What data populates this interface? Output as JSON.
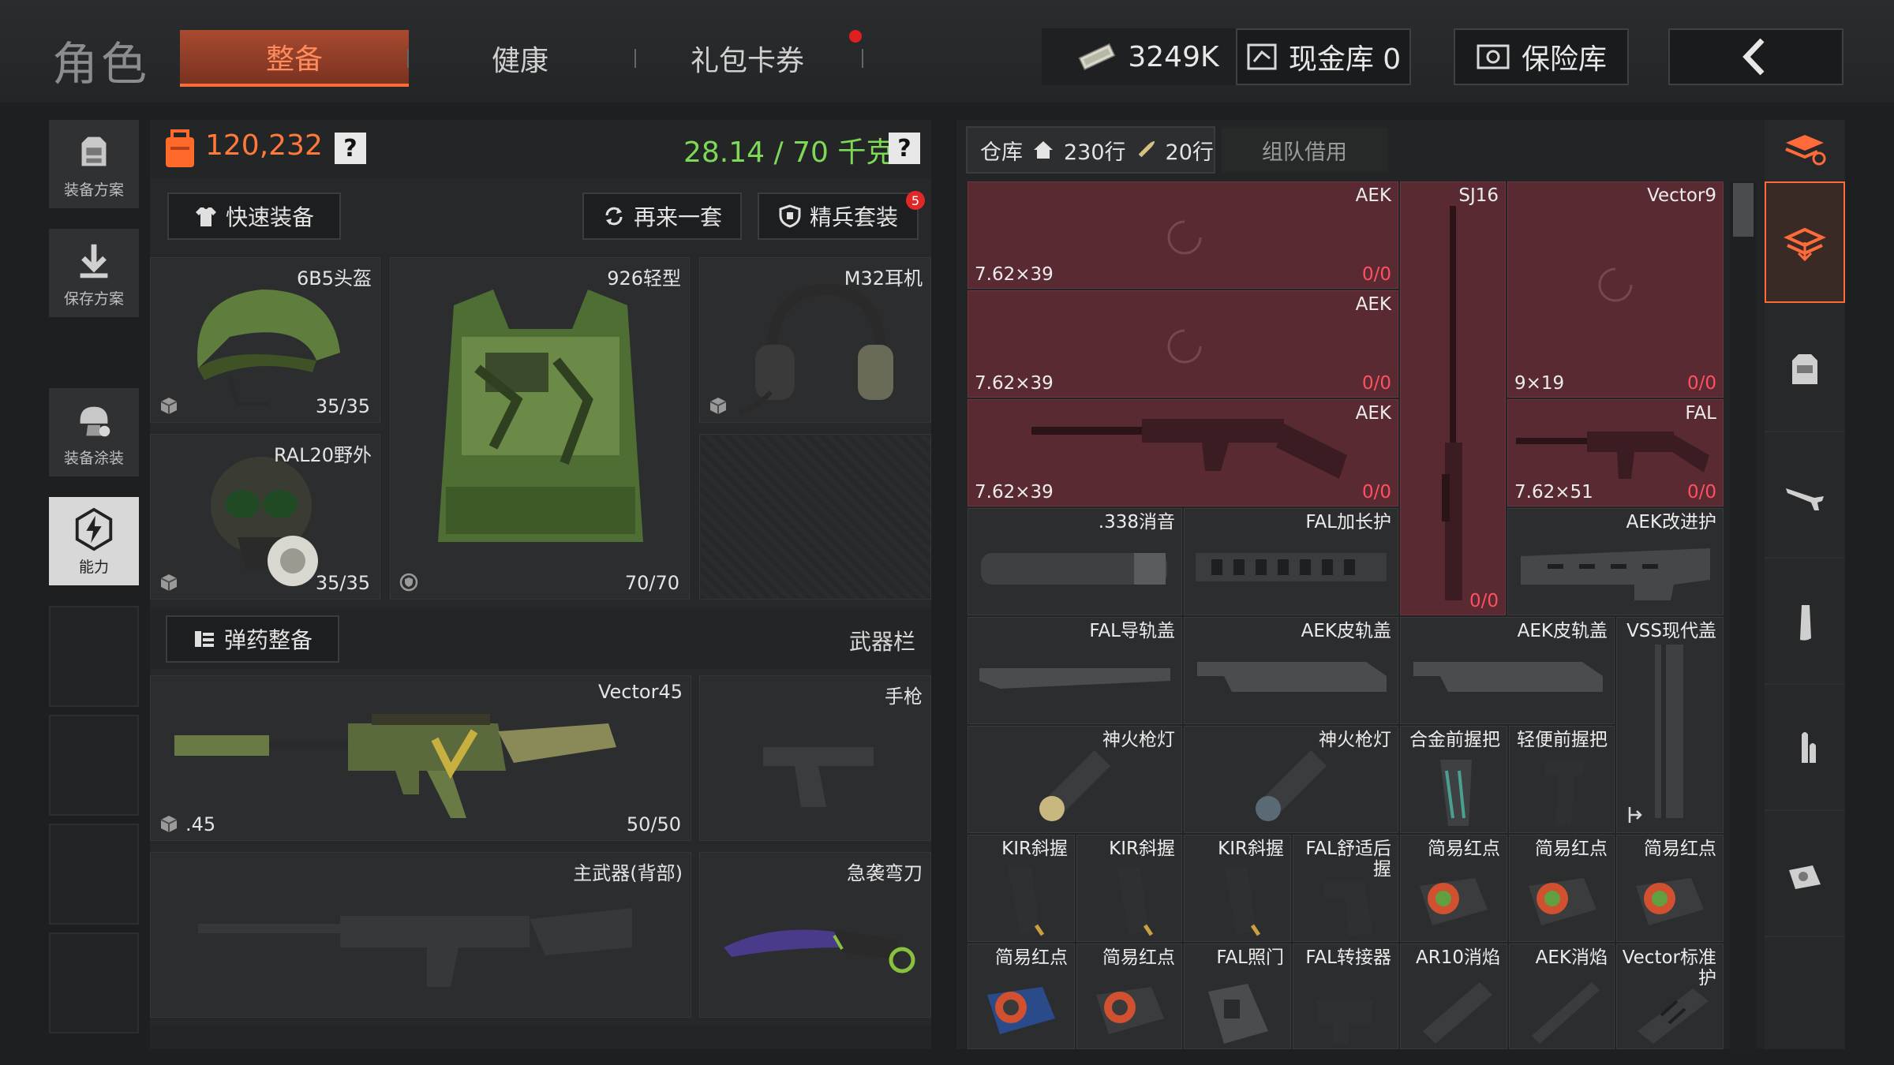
{
  "header": {
    "title": "角色",
    "tabs": [
      {
        "label": "整备",
        "active": true
      },
      {
        "label": "健康",
        "active": false
      },
      {
        "label": "礼包卡券",
        "active": false
      }
    ],
    "money": "3249K",
    "cash_vault": "现金库 0",
    "safe_vault": "保险库"
  },
  "sidebar": {
    "items": [
      {
        "label": "装备方案",
        "icon": "loadout-icon"
      },
      {
        "label": "保存方案",
        "icon": "download-icon"
      },
      {
        "label": "装备涂装",
        "icon": "paint-icon"
      },
      {
        "label": "能力",
        "icon": "ability-icon"
      }
    ]
  },
  "equipment": {
    "value": "120,232",
    "weight": "28.14 / 70 千克",
    "help": "?",
    "quick_equip": "快速装备",
    "repeat_set": "再来一套",
    "elite_set": "精兵套装",
    "elite_badge": "5",
    "slots": {
      "helmet": {
        "name": "6B5头盔",
        "count": "35/35"
      },
      "armor": {
        "name": "926轻型",
        "count": "70/70"
      },
      "headset": {
        "name": "M32耳机"
      },
      "mask": {
        "name": "RAL20野外",
        "count": "35/35"
      }
    },
    "ammo_button": "弹药整备",
    "weapon_bar": "武器栏",
    "primary": {
      "name": "Vector45",
      "caliber": ".45",
      "count": "50/50"
    },
    "pistol": "手枪",
    "back_weapon": "主武器(背部)",
    "knife": "急袭弯刀"
  },
  "warehouse": {
    "tab_label": "仓库",
    "rows_total": "230行",
    "rows_used": "20行",
    "team_borrow": "组队借用",
    "items": [
      {
        "name": "AEK",
        "cal": "7.62×39",
        "count": "0/0"
      },
      {
        "name": "SJ16",
        "count": "0/0"
      },
      {
        "name": "Vector9",
        "cal": "9×19",
        "count": "0/0"
      },
      {
        "name": "AEK",
        "cal": "7.62×39",
        "count": "0/0"
      },
      {
        "name": "AEK",
        "cal": "7.62×39",
        "count": "0/0"
      },
      {
        "name": "FAL",
        "cal": "7.62×51",
        "count": "0/0"
      },
      {
        "name": ".338消音"
      },
      {
        "name": "FAL加长护"
      },
      {
        "name": "AEK改进护"
      },
      {
        "name": "FAL导轨盖"
      },
      {
        "name": "AEK皮轨盖"
      },
      {
        "name": "AEK皮轨盖"
      },
      {
        "name": "VSS现代盖"
      },
      {
        "name": "神火枪灯"
      },
      {
        "name": "神火枪灯"
      },
      {
        "name": "合金前握把"
      },
      {
        "name": "轻便前握把"
      },
      {
        "name": "KIR斜握"
      },
      {
        "name": "KIR斜握"
      },
      {
        "name": "KIR斜握"
      },
      {
        "name": "FAL舒适后握"
      },
      {
        "name": "简易红点"
      },
      {
        "name": "简易红点"
      },
      {
        "name": "简易红点"
      },
      {
        "name": "简易红点"
      },
      {
        "name": "简易红点"
      },
      {
        "name": "FAL照门"
      },
      {
        "name": "FAL转接器"
      },
      {
        "name": "AR10消焰"
      },
      {
        "name": "AEK消焰"
      },
      {
        "name": "Vector标准护"
      }
    ]
  },
  "colors": {
    "accent": "#ff6a3a",
    "weight_green": "#7ed957",
    "value_orange": "#ff7a3a",
    "count_red": "#ff5060",
    "weapon_red": "#5a2a33"
  }
}
